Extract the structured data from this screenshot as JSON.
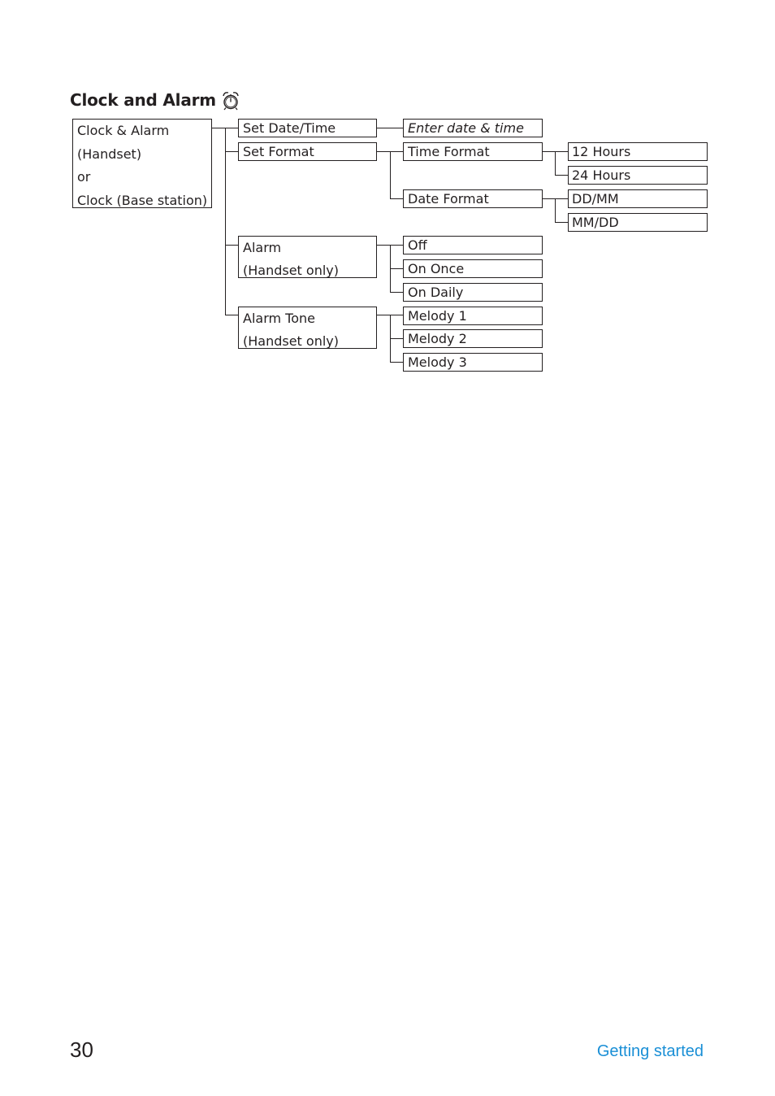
{
  "heading": {
    "title": "Clock and Alarm",
    "icon": "alarm-clock-icon"
  },
  "menu": {
    "root": {
      "lines": [
        "Clock & Alarm",
        "(Handset)",
        "or",
        "Clock (Base station)"
      ]
    },
    "level1": [
      {
        "lines": [
          "Set Date/Time"
        ]
      },
      {
        "lines": [
          "Set Format"
        ]
      },
      {
        "lines": [
          "Alarm",
          "(Handset only)"
        ]
      },
      {
        "lines": [
          "Alarm Tone",
          "(Handset only)"
        ]
      }
    ],
    "level2": {
      "set_date_time": [
        "Enter date & time"
      ],
      "set_format": [
        "Time Format",
        "Date Format"
      ],
      "alarm": [
        "Off",
        "On Once",
        "On Daily"
      ],
      "alarm_tone": [
        "Melody 1",
        "Melody 2",
        "Melody 3"
      ]
    },
    "level3": {
      "time_format": [
        "12 Hours",
        "24 Hours"
      ],
      "date_format": [
        "DD/MM",
        "MM/DD"
      ]
    }
  },
  "footer": {
    "page_number": "30",
    "section": "Getting started",
    "section_color": "#1a8fd6"
  }
}
